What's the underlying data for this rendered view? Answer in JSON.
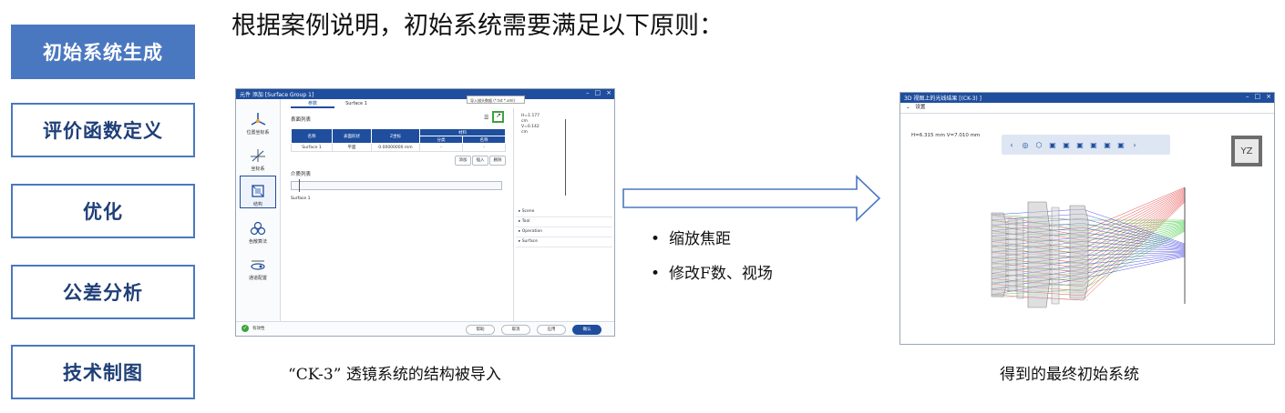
{
  "nav": {
    "items": [
      {
        "label": "初始系统生成",
        "active": true
      },
      {
        "label": "评价函数定义",
        "active": false
      },
      {
        "label": "优化",
        "active": false
      },
      {
        "label": "公差分析",
        "active": false
      },
      {
        "label": "技术制图",
        "active": false
      }
    ]
  },
  "headline": "根据案例说明，初始系统需要满足以下原则：",
  "dialog": {
    "title": "元件 添加 [Surface Group 1]",
    "tabs": [
      "参数",
      "Surface 1"
    ],
    "tooltip": "导入描头数据 (*.txt *.xml)",
    "surface_list_label": "表面列表",
    "table": {
      "headers": [
        "名称",
        "表面形状",
        "Z坐标",
        "材料"
      ],
      "material_sub": [
        "分类",
        "名称"
      ],
      "row": [
        "Surface 1",
        "平面",
        "0.00000000 mm",
        "-",
        "-"
      ]
    },
    "buttons": [
      "添加",
      "插入",
      "删除"
    ],
    "medium_list_label": "介质列表",
    "surface_tag": "Surface 1",
    "sidebar": [
      "位置坐标系",
      "坐标系",
      "结构",
      "色散算法",
      "通道配置"
    ],
    "info_lines": [
      "H=1.177",
      "cm",
      "V=0.142",
      "cm"
    ],
    "tree": [
      "Scene",
      "Tool",
      "Operation",
      "Surface"
    ],
    "status": "有效性",
    "footer_buttons": [
      "帮助",
      "取消",
      "应用",
      "确认"
    ]
  },
  "caption_left": "“CK-3” 透镜系统的结构被导入",
  "bullets": [
    "缩放焦距",
    "修改F数、视场"
  ],
  "view3d": {
    "title": "3D 视图上的光线结果 [(CK-3) ]",
    "settings": "设置",
    "hv": "H=6.315 mm V=7.010 mm",
    "cube_label": "YZ",
    "colors": {
      "red": "#e21b1b",
      "green": "#1fc31f",
      "blue": "#2a2ae0",
      "gray": "#8a8a8a"
    }
  },
  "caption_right": "得到的最终初始系统"
}
